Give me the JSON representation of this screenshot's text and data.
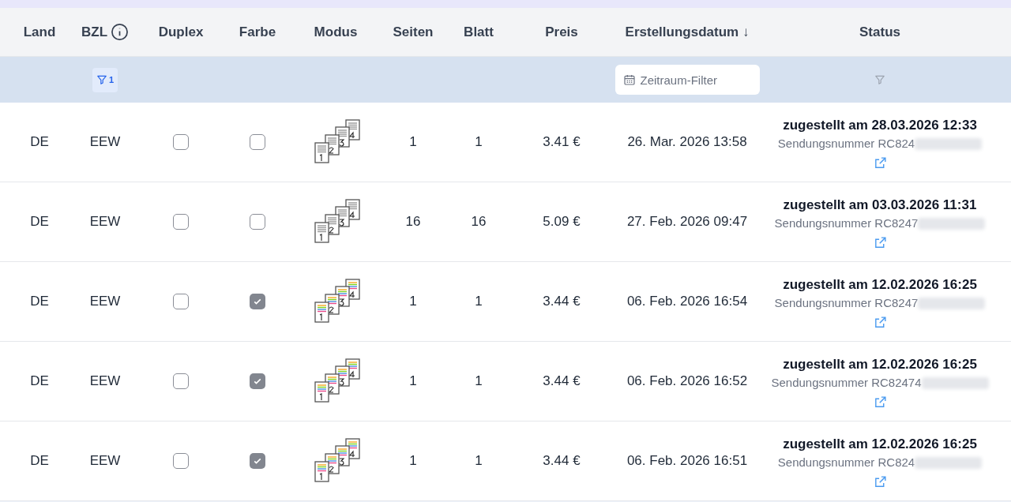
{
  "table": {
    "columns": [
      {
        "label": "Land"
      },
      {
        "label": "BZL",
        "info": true
      },
      {
        "label": "Duplex"
      },
      {
        "label": "Farbe"
      },
      {
        "label": "Modus"
      },
      {
        "label": "Seiten"
      },
      {
        "label": "Blatt"
      },
      {
        "label": "Preis"
      },
      {
        "label": "Erstellungsdatum ↓"
      },
      {
        "label": "Status"
      }
    ],
    "filters": {
      "bzl_count": "1",
      "date_placeholder": "Zeitraum-Filter"
    },
    "rows": [
      {
        "land": "DE",
        "bzl": "EEW",
        "duplex": false,
        "farbe": false,
        "seiten": "1",
        "blatt": "1",
        "preis": "3.41 €",
        "datum": "26. Mar. 2026 13:58",
        "status": "zugestellt am 28.03.2026 12:33",
        "sendung": "Sendungsnummer RC824"
      },
      {
        "land": "DE",
        "bzl": "EEW",
        "duplex": false,
        "farbe": false,
        "seiten": "16",
        "blatt": "16",
        "preis": "5.09 €",
        "datum": "27. Feb. 2026 09:47",
        "status": "zugestellt am 03.03.2026 11:31",
        "sendung": "Sendungsnummer RC8247"
      },
      {
        "land": "DE",
        "bzl": "EEW",
        "duplex": false,
        "farbe": true,
        "seiten": "1",
        "blatt": "1",
        "preis": "3.44 €",
        "datum": "06. Feb. 2026 16:54",
        "status": "zugestellt am 12.02.2026 16:25",
        "sendung": "Sendungsnummer RC8247"
      },
      {
        "land": "DE",
        "bzl": "EEW",
        "duplex": false,
        "farbe": true,
        "seiten": "1",
        "blatt": "1",
        "preis": "3.44 €",
        "datum": "06. Feb. 2026 16:52",
        "status": "zugestellt am 12.02.2026 16:25",
        "sendung": "Sendungsnummer RC82474"
      },
      {
        "land": "DE",
        "bzl": "EEW",
        "duplex": false,
        "farbe": true,
        "seiten": "1",
        "blatt": "1",
        "preis": "3.44 €",
        "datum": "06. Feb. 2026 16:51",
        "status": "zugestellt am 12.02.2026 16:25",
        "sendung": "Sendungsnummer RC824"
      }
    ]
  }
}
